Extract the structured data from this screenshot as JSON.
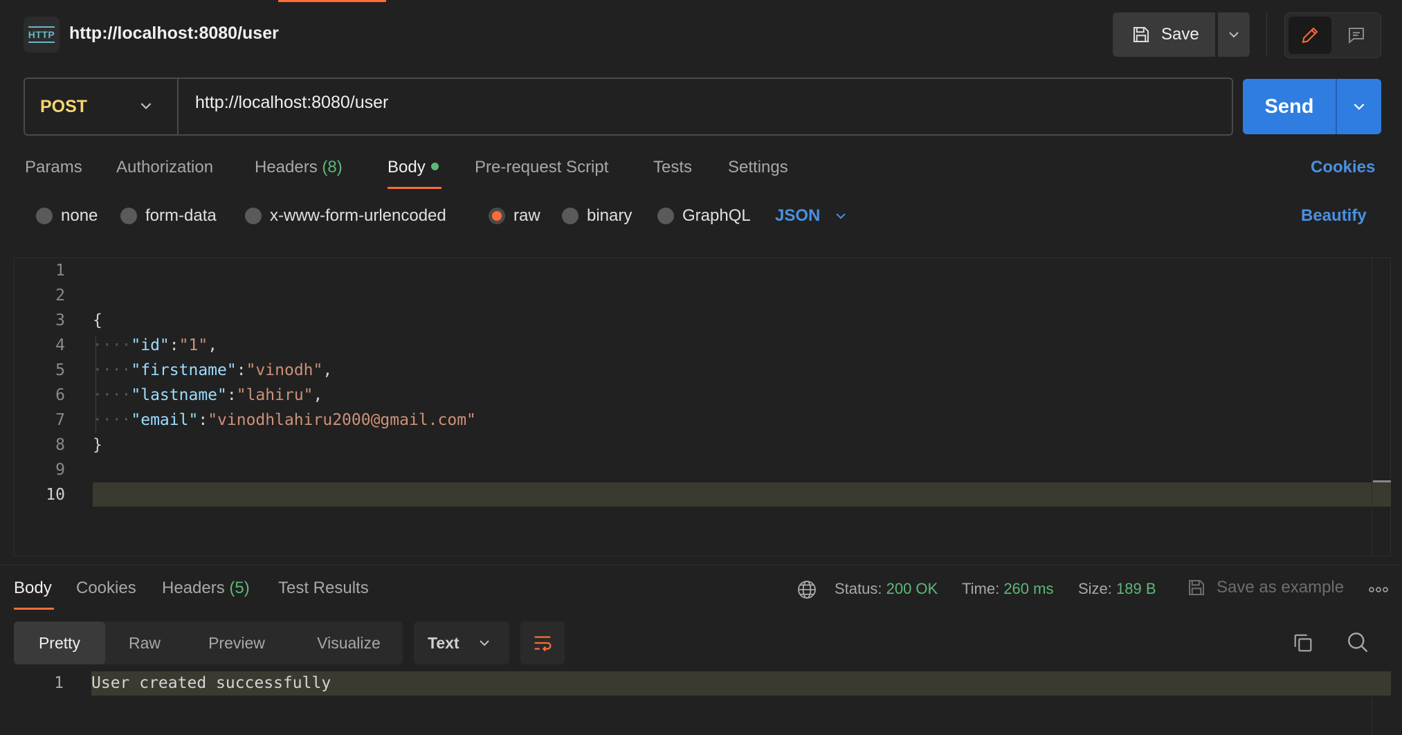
{
  "header": {
    "icon_text": "HTTP",
    "title": "http://localhost:8080/user",
    "save_label": "Save"
  },
  "request": {
    "method": "POST",
    "url": "http://localhost:8080/user",
    "send_label": "Send"
  },
  "tabs": {
    "params": "Params",
    "authorization": "Authorization",
    "headers": "Headers",
    "headers_count": "(8)",
    "body": "Body",
    "prerequest": "Pre-request Script",
    "tests": "Tests",
    "settings": "Settings",
    "cookies": "Cookies"
  },
  "body_types": {
    "none": "none",
    "form_data": "form-data",
    "urlencoded": "x-www-form-urlencoded",
    "raw": "raw",
    "binary": "binary",
    "graphql": "GraphQL",
    "format": "JSON",
    "beautify": "Beautify",
    "selected": "raw"
  },
  "editor": {
    "line_numbers": [
      "1",
      "2",
      "3",
      "4",
      "5",
      "6",
      "7",
      "8",
      "9",
      "10"
    ],
    "lines": {
      "l3": "{",
      "l4_key": "\"id\"",
      "l4_val": "\"1\"",
      "l5_key": "\"firstname\"",
      "l5_val": "\"vinodh\"",
      "l6_key": "\"lastname\"",
      "l6_val": "\"lahiru\"",
      "l7_key": "\"email\"",
      "l7_val": "\"vinodhlahiru2000@gmail.com\"",
      "l8": "}"
    }
  },
  "response": {
    "tabs": {
      "body": "Body",
      "cookies": "Cookies",
      "headers": "Headers",
      "headers_count": "(5)",
      "test_results": "Test Results"
    },
    "status_label": "Status:",
    "status_value": "200 OK",
    "time_label": "Time:",
    "time_value": "260 ms",
    "size_label": "Size:",
    "size_value": "189 B",
    "save_example": "Save as example",
    "views": {
      "pretty": "Pretty",
      "raw": "Raw",
      "preview": "Preview",
      "visualize": "Visualize"
    },
    "format": "Text",
    "line_number": "1",
    "body_text": "User created successfully"
  },
  "colors": {
    "accent": "#ff6c37",
    "send": "#2f7de1",
    "method": "#f5d76e",
    "success": "#5fb878",
    "link": "#4a90e2"
  }
}
